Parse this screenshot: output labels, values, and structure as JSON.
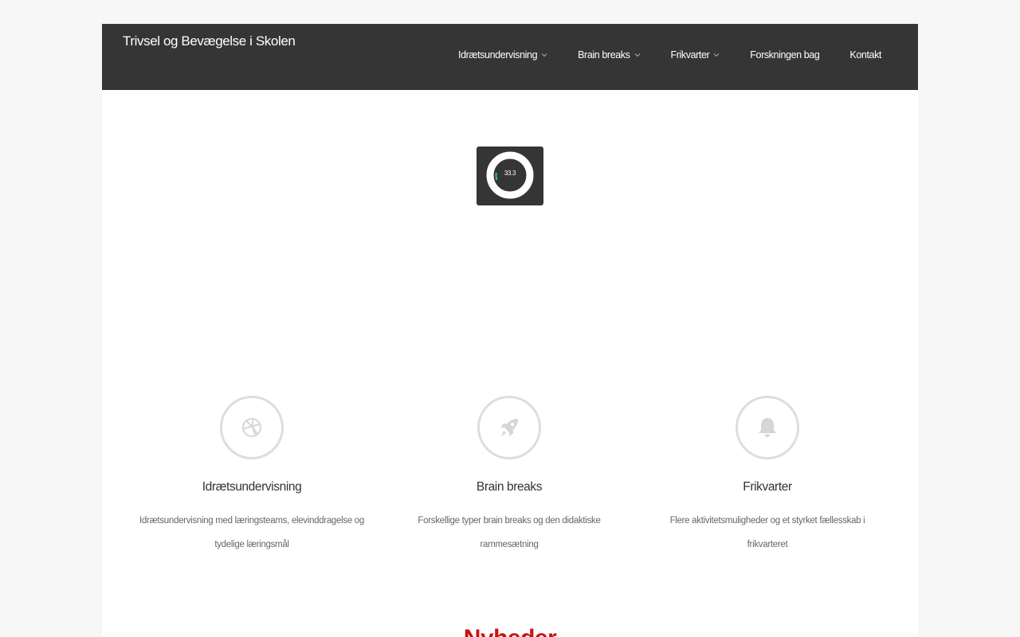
{
  "header": {
    "site_title": "Trivsel og Bevægelse i Skolen",
    "nav": [
      {
        "label": "Idrætsundervisning",
        "has_dropdown": true
      },
      {
        "label": "Brain breaks",
        "has_dropdown": true
      },
      {
        "label": "Frikvarter",
        "has_dropdown": true
      },
      {
        "label": "Forskningen bag",
        "has_dropdown": false
      },
      {
        "label": "Kontakt",
        "has_dropdown": false
      }
    ]
  },
  "loader": {
    "value_label": "33.3",
    "progress_percent": 33.3,
    "track_color": "#ffffff",
    "fill_color": "#2ecc71"
  },
  "features": [
    {
      "icon": "basketball-icon",
      "title": "Idrætsundervisning",
      "description": "Idrætsundervisning med læringsteams, elevinddragelse og tydelige læringsmål"
    },
    {
      "icon": "rocket-icon",
      "title": "Brain breaks",
      "description": "Forskellige typer brain breaks og den didaktiske rammesætning"
    },
    {
      "icon": "bell-icon",
      "title": "Frikvarter",
      "description": "Flere aktivitetsmuligheder og et styrket fællesskab i frikvarteret"
    }
  ],
  "section_heading": "Nyheder",
  "colors": {
    "header_bg": "#353535",
    "page_bg": "#f7f7f7",
    "icon_gray": "#dddddd",
    "accent_red": "#cc1111"
  }
}
